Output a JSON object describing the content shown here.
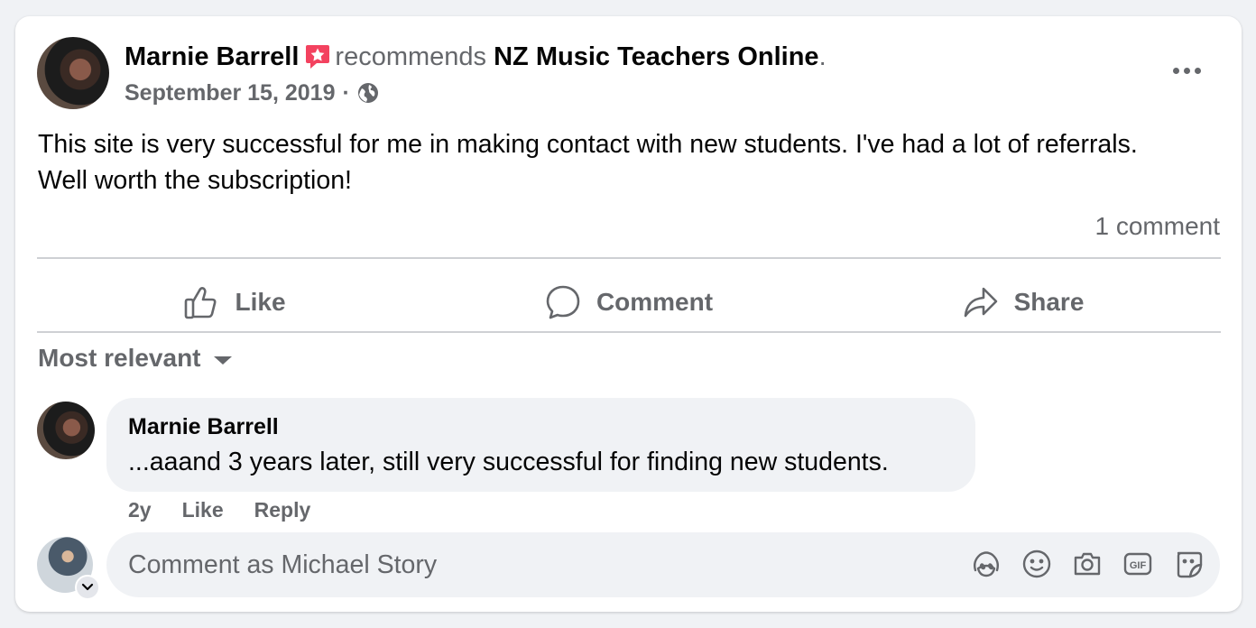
{
  "post": {
    "author": "Marnie Barrell",
    "verb": "recommends",
    "page_name": "NZ Music Teachers Online",
    "punct": ".",
    "date": "September 15, 2019",
    "separator": "·",
    "audience_icon": "globe-icon",
    "recommend_icon": "recommend-star-icon",
    "more_icon": "more-options-icon",
    "text": "This site is very successful for me in making contact with new students. I've had a lot of referrals. Well worth the subscription!",
    "comment_count": "1 comment"
  },
  "actions": [
    {
      "label": "Like",
      "icon": "thumbs-up-icon"
    },
    {
      "label": "Comment",
      "icon": "comment-bubble-icon"
    },
    {
      "label": "Share",
      "icon": "share-arrow-icon"
    }
  ],
  "comments_section": {
    "sort_label": "Most relevant",
    "sort_icon": "caret-down-icon",
    "comments": [
      {
        "author": "Marnie Barrell",
        "text": "...aaand 3 years later, still very successful for finding new students.",
        "age": "2y",
        "like": "Like",
        "reply": "Reply"
      }
    ]
  },
  "composer": {
    "placeholder": "Comment as Michael Story",
    "tools": [
      "avatar-sticker-icon",
      "emoji-icon",
      "camera-icon",
      "gif-icon",
      "sticker-icon"
    ]
  },
  "colors": {
    "background": "#f0f2f5",
    "card": "#ffffff",
    "secondary_text": "#65676b",
    "primary_text": "#050505",
    "recommend_badge": "#f3425f"
  }
}
